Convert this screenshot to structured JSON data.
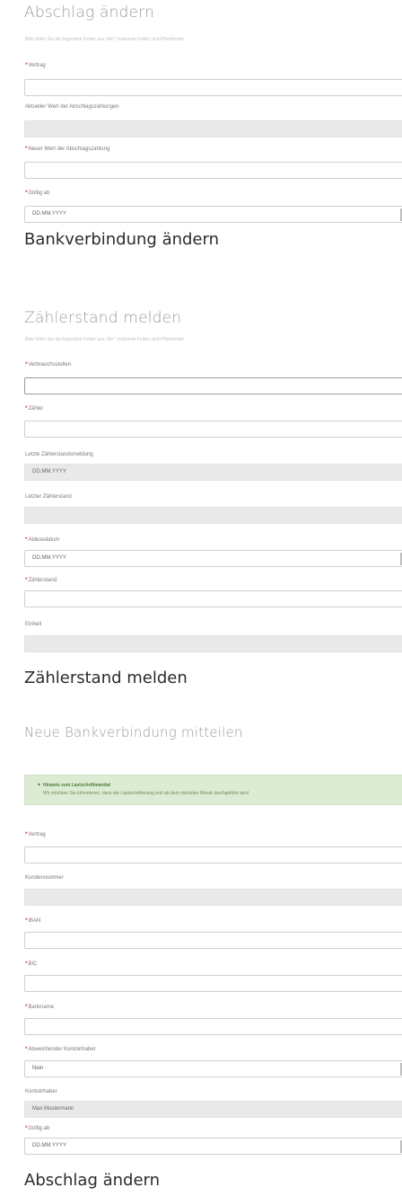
{
  "section1": {
    "title": "Abschlag ändern",
    "subtitle": "Bitte füllen Sie die folgenden Felder aus. Mit * markierte Felder sind Pflichtfelder.",
    "fields": [
      {
        "label": "Vertrag",
        "required": true,
        "value": ""
      },
      {
        "label": "Aktueller Wert der Abschlagszahlungen",
        "required": false,
        "value": ""
      },
      {
        "label": "Neuer Wert der Abschlagszahlung",
        "required": true,
        "value": ""
      },
      {
        "label": "Gültig ab",
        "required": true,
        "value": "DD.MM.YYYY"
      }
    ],
    "caption": "Bankverbindung ändern"
  },
  "section2": {
    "title": "Zählerstand melden",
    "subtitle": "Bitte füllen Sie die folgenden Felder aus. Mit * markierte Felder sind Pflichtfelder.",
    "fields": [
      {
        "label": "Verbrauchsstellen",
        "required": true,
        "value": ""
      },
      {
        "label": "Zähler",
        "required": true,
        "value": ""
      },
      {
        "label": "Letzte Zählerstandsmeldung",
        "required": false,
        "value": "DD.MM.YYYY"
      },
      {
        "label": "Letzter Zählerstand",
        "required": false,
        "value": ""
      },
      {
        "label": "Ablesedatum",
        "required": true,
        "value": "DD.MM.YYYY"
      },
      {
        "label": "Zählerstand",
        "required": true,
        "value": ""
      },
      {
        "label": "Einheit",
        "required": false,
        "value": ""
      }
    ],
    "caption": "Zählerstand melden"
  },
  "section3": {
    "title": "Neue Bankverbindung mitteilen",
    "alert_title": "Hinweis zum Lastschriftmandat",
    "alert_text": "Wir möchten Sie informieren, dass der Lastschrifteinzug erst ab dem nächsten Monat durchgeführt wird.",
    "fields": [
      {
        "label": "Vertrag",
        "required": true,
        "value": ""
      },
      {
        "label": "Kundennummer",
        "required": false,
        "value": ""
      },
      {
        "label": "IBAN",
        "required": true,
        "value": ""
      },
      {
        "label": "BIC",
        "required": true,
        "value": ""
      },
      {
        "label": "Bankname",
        "required": true,
        "value": ""
      },
      {
        "label": "Abweichender Kontoinhaber",
        "required": true,
        "value": "Nein"
      },
      {
        "label": "Kontoinhaber",
        "required": false,
        "value": "Max Mustermann"
      },
      {
        "label": "Gültig ab",
        "required": true,
        "value": "DD.MM.YYYY"
      }
    ],
    "caption": "Abschlag ändern"
  },
  "colors": {
    "required": "#e0302f",
    "alert_bg": "#dcebd3",
    "readonly_bg": "#e9e9e9"
  },
  "icons": {
    "alert": "warning-icon"
  }
}
